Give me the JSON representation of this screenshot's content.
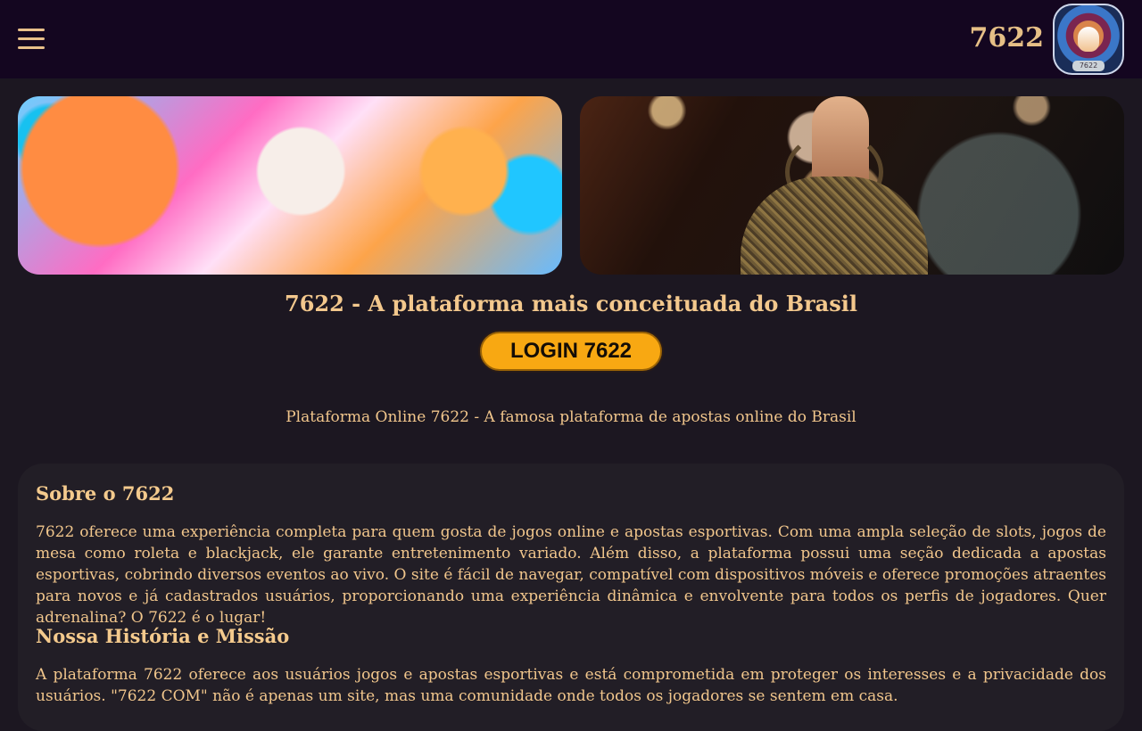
{
  "header": {
    "brand": "7622",
    "logo_badge": "7622",
    "icons": {
      "menu": "menu-icon"
    }
  },
  "banners": {
    "left": "tiger-banner",
    "right": "woman-banner"
  },
  "hero": {
    "heading": "7622 - A plataforma mais conceituada do Brasil",
    "login_label": "LOGIN  7622",
    "subtitle": "Plataforma Online 7622 - A famosa plataforma de apostas online do Brasil"
  },
  "content": {
    "sections": [
      {
        "title": "Sobre o 7622",
        "body": "7622 oferece uma experiência completa para quem gosta de jogos online e apostas esportivas. Com uma ampla seleção de slots, jogos de mesa como roleta e blackjack, ele garante entretenimento variado. Além disso, a plataforma possui uma seção dedicada a apostas esportivas, cobrindo diversos eventos ao vivo. O site é fácil de navegar, compatível com dispositivos móveis e oferece promoções atraentes para novos e já cadastrados usuários, proporcionando uma experiência dinâmica e envolvente para todos os perfis de jogadores. Quer adrenalina? O 7622 é o lugar!"
      },
      {
        "title": "Nossa História e Missão",
        "body": "A plataforma 7622 oferece aos usuários jogos e apostas esportivas e está comprometida em proteger os interesses e a privacidade dos usuários. \"7622 COM\" não é apenas um site, mas uma comunidade onde todos os jogadores se sentem em casa."
      }
    ]
  }
}
